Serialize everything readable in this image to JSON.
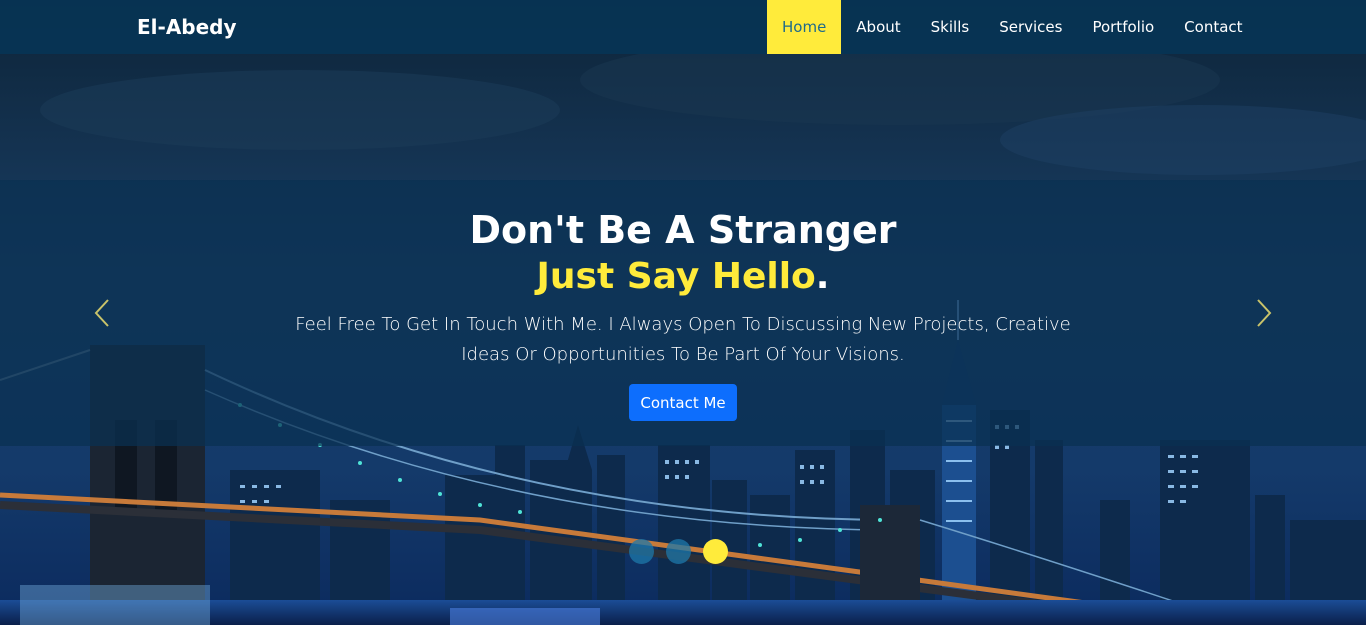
{
  "nav": {
    "brand": "El-Abedy",
    "links": [
      {
        "label": "Home"
      },
      {
        "label": "About"
      },
      {
        "label": "Skills"
      },
      {
        "label": "Services"
      },
      {
        "label": "Portfolio"
      },
      {
        "label": "Contact"
      }
    ],
    "active_index": 0
  },
  "hero": {
    "headline": "Don't Be A Stranger",
    "subline_highlight": "Just Say Hello",
    "subline_punct": ".",
    "description": "Feel Free To Get In Touch With Me. I Always Open To Discussing New Projects, Creative Ideas Or Opportunities To Be Part Of Your Visions.",
    "cta_label": "Contact Me"
  },
  "carousel": {
    "slides_count": 3,
    "active_slide": 3,
    "prev_icon": "chevron-left-icon",
    "next_icon": "chevron-right-icon"
  },
  "colors": {
    "accent": "#ffeb3b",
    "nav_bg": "#063455",
    "cta": "#0d6efd",
    "active_link_text": "#1e6a8a"
  }
}
